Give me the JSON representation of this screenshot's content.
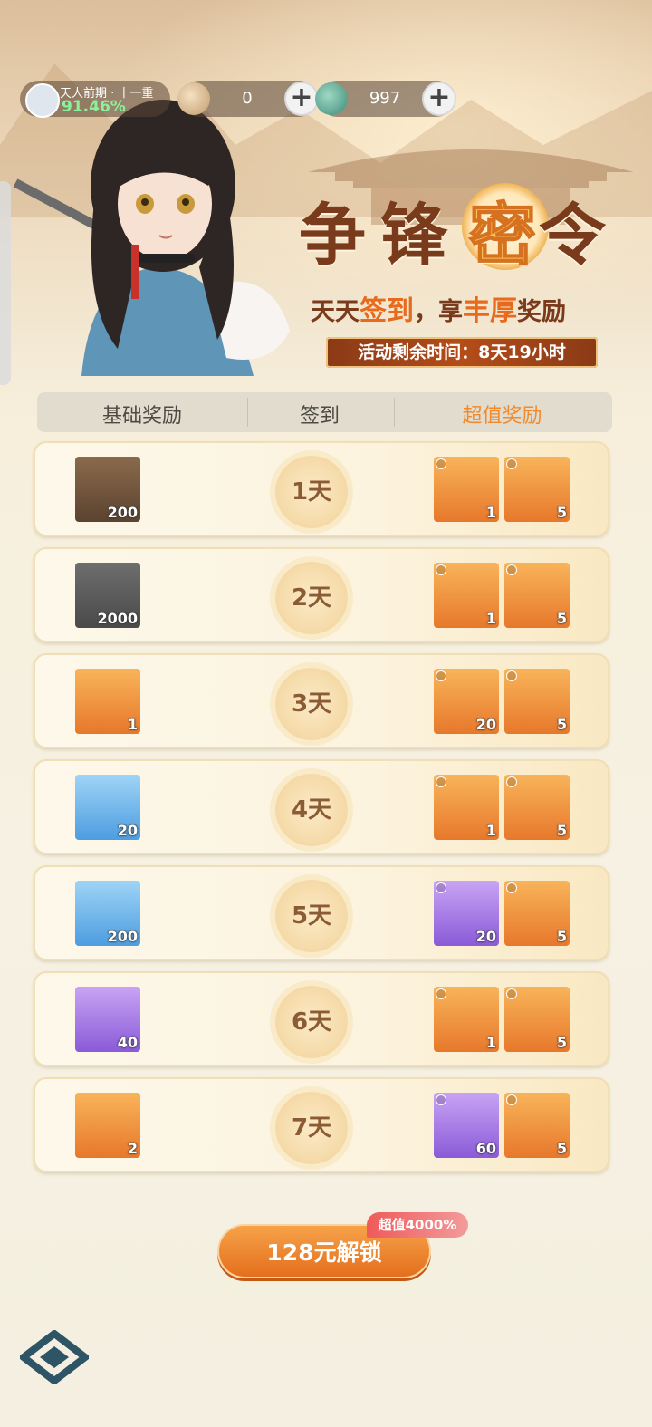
{
  "header": {
    "realm": {
      "name": "天人前期 · 十一重",
      "percent": "91.46%"
    },
    "currency1": {
      "value": "0",
      "plus": "+"
    },
    "currency2": {
      "value": "997",
      "plus": "+"
    }
  },
  "event": {
    "title_chars": [
      "争",
      "锋",
      "密",
      "令"
    ],
    "slogan_part1": "天天",
    "slogan_hl1": "签到",
    "slogan_part2": "，享",
    "slogan_hl2": "丰厚",
    "slogan_part3": "奖励",
    "timer": "活动剩余时间：8天19小时"
  },
  "columns": {
    "basic": "基础奖励",
    "signin": "签到",
    "super": "超值奖励"
  },
  "days": [
    {
      "day": "1天",
      "base": {
        "icon": "jade-check-token-icon",
        "qty": "200"
      },
      "super": [
        {
          "icon": "ice-boots-icon",
          "qty": "1"
        },
        {
          "icon": "golden-key-icon",
          "qty": "5"
        }
      ]
    },
    {
      "day": "2天",
      "base": {
        "icon": "jade-check-token-icon",
        "qty": "2000"
      },
      "super": [
        {
          "icon": "lantern-chest-icon",
          "qty": "1"
        },
        {
          "icon": "golden-key-icon",
          "qty": "5"
        }
      ]
    },
    {
      "day": "3天",
      "base": {
        "icon": "scroll-icon",
        "qty": "1"
      },
      "super": [
        {
          "icon": "purple-crystal-icon",
          "qty": "20"
        },
        {
          "icon": "golden-key-icon",
          "qty": "5"
        }
      ]
    },
    {
      "day": "4天",
      "base": {
        "icon": "puzzle-gem-icon",
        "qty": "20"
      },
      "super": [
        {
          "icon": "ice-boots-icon",
          "qty": "1"
        },
        {
          "icon": "golden-key-icon",
          "qty": "5"
        }
      ]
    },
    {
      "day": "5天",
      "base": {
        "icon": "cyan-pyramid-icon",
        "qty": "200"
      },
      "super": [
        {
          "icon": "red-treasure-chest-icon",
          "qty": "20"
        },
        {
          "icon": "golden-key-icon",
          "qty": "5"
        }
      ]
    },
    {
      "day": "6天",
      "base": {
        "icon": "crystal-shard-icon",
        "qty": "40"
      },
      "super": [
        {
          "icon": "ice-boots-icon",
          "qty": "1"
        },
        {
          "icon": "golden-key-icon",
          "qty": "5"
        }
      ]
    },
    {
      "day": "7天",
      "base": {
        "icon": "purple-crystal-icon",
        "qty": "2"
      },
      "super": [
        {
          "icon": "red-treasure-chest-icon",
          "qty": "60"
        },
        {
          "icon": "golden-key-icon",
          "qty": "5"
        }
      ]
    }
  ],
  "unlock": {
    "label": "128元解锁",
    "badge": "超值4000%"
  },
  "colors": {
    "accent": "#e46f1c",
    "title": "#7a3a1c",
    "super_header": "#f08a2c"
  }
}
